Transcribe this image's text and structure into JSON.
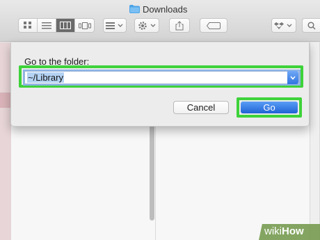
{
  "window": {
    "title": "Downloads"
  },
  "toolbar": {
    "view_modes": [
      "icon-view",
      "list-view",
      "column-view",
      "cover-flow-view"
    ],
    "active_view": "column-view"
  },
  "dialog": {
    "label": "Go to the folder:",
    "path_value": "~/Library",
    "cancel_label": "Cancel",
    "go_label": "Go"
  },
  "colors": {
    "highlight_green": "#3ed23a",
    "go_blue": "#2f74e0"
  },
  "watermark": {
    "part1": "wiki",
    "part2": "How"
  }
}
